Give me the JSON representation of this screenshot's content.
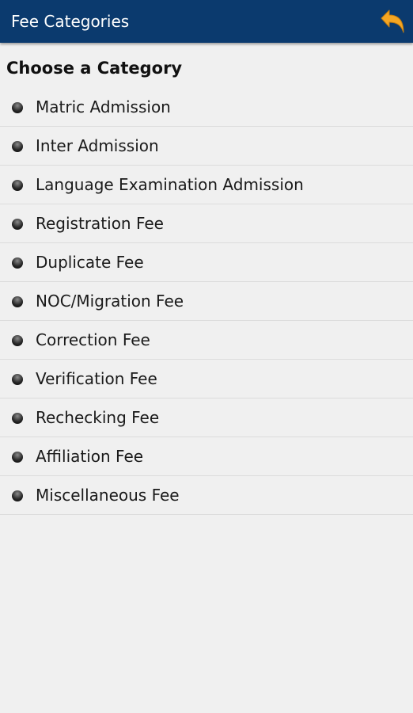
{
  "app_bar": {
    "title": "Fee Categories",
    "back_icon": "back-arrow-icon",
    "back_icon_color": "#f5a623",
    "background_color": "#0b3a6e"
  },
  "main": {
    "heading": "Choose a Category",
    "items": [
      {
        "label": "Matric Admission"
      },
      {
        "label": "Inter Admission"
      },
      {
        "label": "Language Examination Admission"
      },
      {
        "label": "Registration Fee"
      },
      {
        "label": "Duplicate Fee"
      },
      {
        "label": "NOC/Migration Fee"
      },
      {
        "label": "Correction Fee"
      },
      {
        "label": "Verification Fee"
      },
      {
        "label": "Rechecking Fee"
      },
      {
        "label": "Affiliation Fee"
      },
      {
        "label": "Miscellaneous Fee"
      }
    ]
  }
}
